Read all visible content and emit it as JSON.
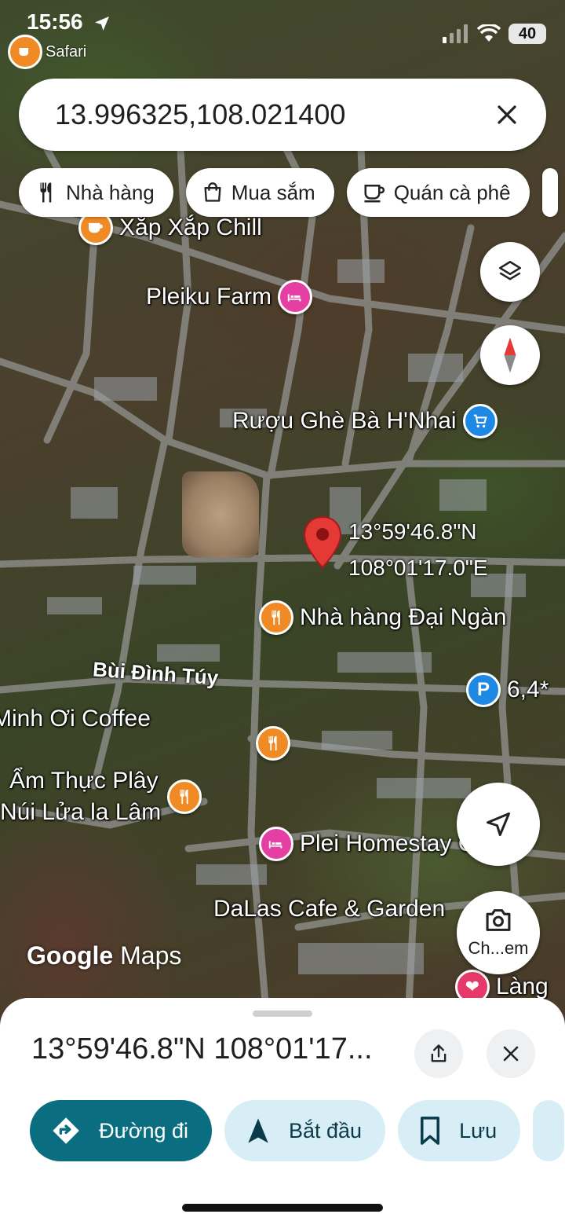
{
  "status_bar": {
    "time": "15:56",
    "back_app": "Safari",
    "battery": "40"
  },
  "search": {
    "query": "13.996325,108.021400",
    "clear_icon": "close-icon"
  },
  "categories": [
    {
      "label": "Nhà hàng",
      "icon": "fork-knife-icon"
    },
    {
      "label": "Mua sắm",
      "icon": "shopping-bag-icon"
    },
    {
      "label": "Quán cà phê",
      "icon": "coffee-cup-icon"
    }
  ],
  "map": {
    "places": {
      "xap_xap": "Xắp Xắp Chill",
      "pleiku_farm": "Pleiku Farm",
      "ruou_ghe": "Rượu Ghè Bà H'Nhai",
      "dai_ngan": "Nhà hàng Đại Ngàn",
      "minh_oi": "Minh Ơi Coffee",
      "am_thuc": "Ẩm Thực Plây Núi Lửa la Lâm",
      "am_thuc_line1": "Ẩm Thực Plây",
      "am_thuc_line2": "Núi Lửa la Lâm",
      "plei_homestay": "Plei Homestay Cafe",
      "dalas": "DaLas Cafe & Garden",
      "lang": "Làng",
      "parking": "6,4*"
    },
    "road": "Bùi Đình Túy",
    "dropped_pin": {
      "lat": "13°59'46.8\"N",
      "lng": "108°01'17.0\"E"
    },
    "logo": {
      "google": "Google",
      "maps": "Maps"
    },
    "camera_label": "Ch...em"
  },
  "sheet": {
    "title": "13°59'46.8\"N 108°01'17...",
    "actions": [
      {
        "label": "Đường đi",
        "icon": "directions-icon"
      },
      {
        "label": "Bắt đầu",
        "icon": "navigation-arrow-icon"
      },
      {
        "label": "Lưu",
        "icon": "bookmark-icon"
      }
    ]
  },
  "colors": {
    "primary": "#0b6e80",
    "secondary_chip": "#d8eef6",
    "pin_red": "#e53935",
    "poi_orange": "#f08a24",
    "poi_pink": "#e63fa3",
    "poi_blue": "#1e88e5"
  }
}
